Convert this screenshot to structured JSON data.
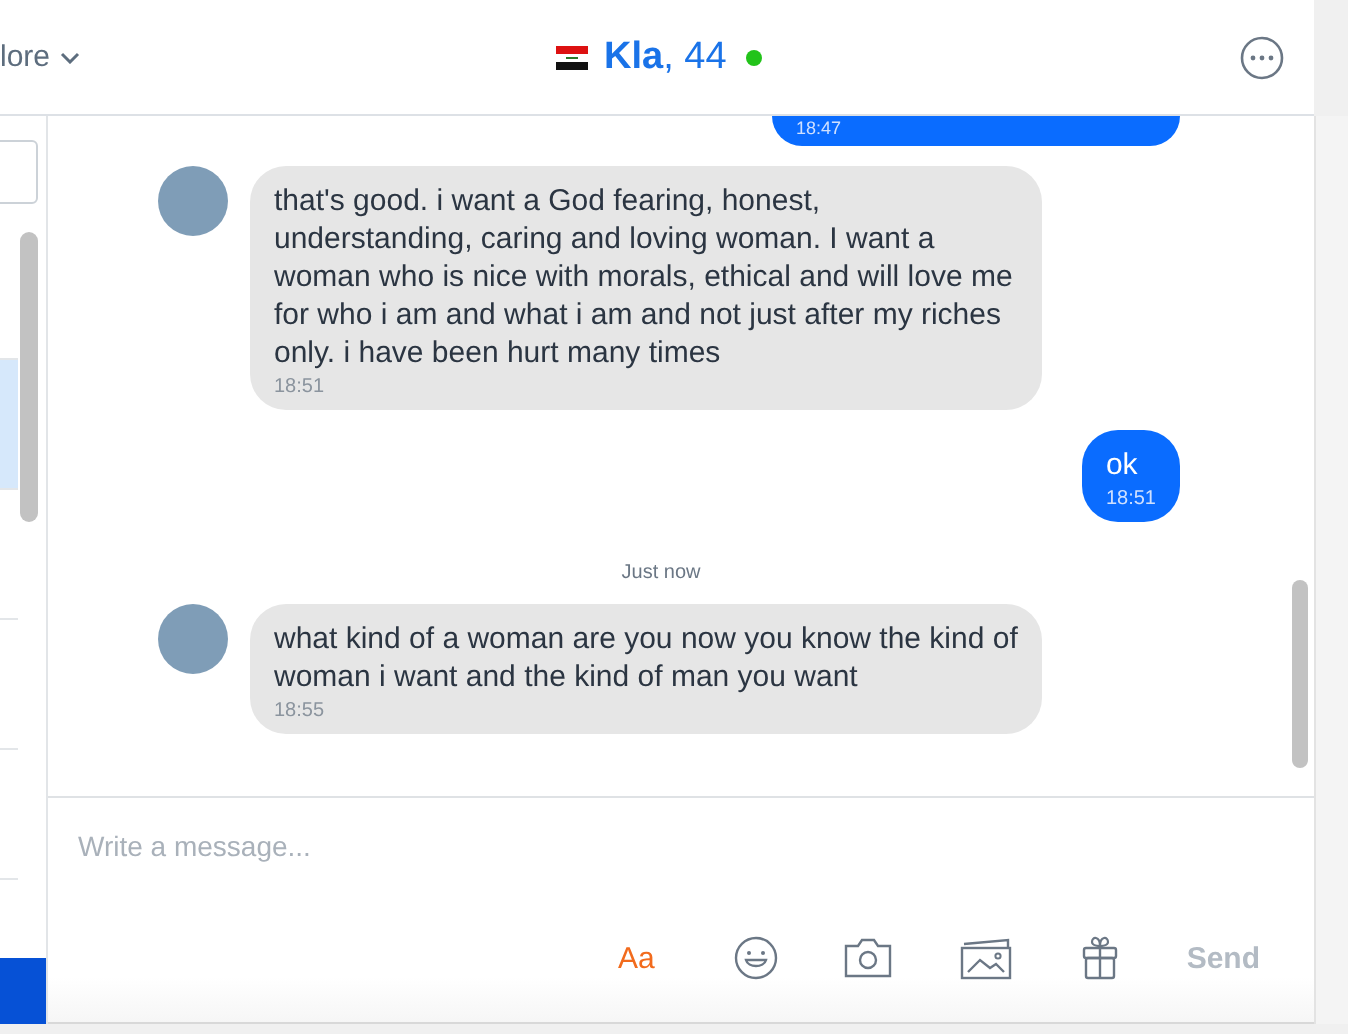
{
  "top_bar": {
    "menu_label": "lore"
  },
  "sidebar": {
    "rows": [
      {
        "selected": false
      },
      {
        "selected": true
      },
      {
        "selected": false
      },
      {
        "selected": false
      },
      {
        "selected": false
      }
    ]
  },
  "header": {
    "name": "Kla",
    "age": ", 44",
    "online": true
  },
  "messages": [
    {
      "kind": "outgoing",
      "time": "18:47"
    },
    {
      "kind": "incoming",
      "text": "that's good. i want a God fearing, honest, understanding, caring and loving woman. I want a woman who is nice with morals, ethical and will love me for who i am and what i am and not just after my riches only. i have been hurt many times",
      "time": "18:51"
    },
    {
      "kind": "outgoing",
      "text": "ok",
      "time": "18:51"
    },
    {
      "kind": "divider",
      "text": "Just now"
    },
    {
      "kind": "incoming",
      "text": "what kind of a woman are you now you know the kind of woman i want and the kind of man you want",
      "time": "18:55"
    }
  ],
  "composer": {
    "placeholder": "Write a message...",
    "format_label": "Aa",
    "send_label": "Send",
    "send_disabled": true
  }
}
